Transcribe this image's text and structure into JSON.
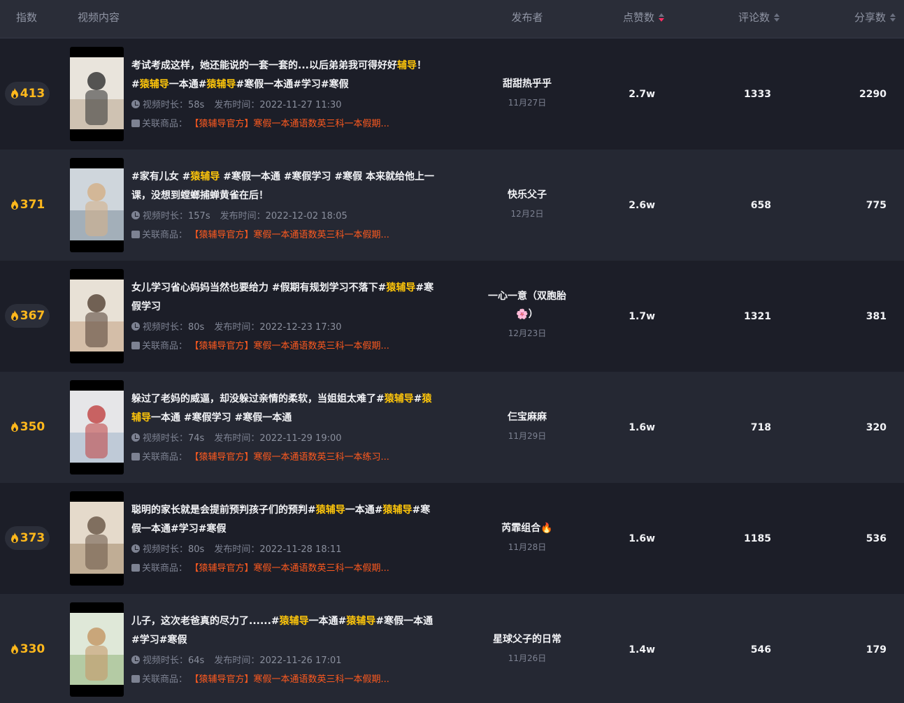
{
  "columns": {
    "index": "指数",
    "content": "视频内容",
    "author": "发布者",
    "likes": "点赞数",
    "comments": "评论数",
    "shares": "分享数"
  },
  "labels": {
    "duration": "视频时长：",
    "published": "发布时间：",
    "product": "关联商品："
  },
  "colors": {
    "accent": "#ffc60a",
    "index": "#ffb81c",
    "product": "#ff5a1f",
    "sort_active": "#ff2e63"
  },
  "rows": [
    {
      "index": "413",
      "title_parts": [
        {
          "t": "考试考成这样，她还能说的一套一套的...以后弟弟我可得好好",
          "h": false
        },
        {
          "t": "辅导",
          "h": true
        },
        {
          "t": "！ #",
          "h": false
        },
        {
          "t": "猿辅导",
          "h": true
        },
        {
          "t": "一本通#",
          "h": false
        },
        {
          "t": "猿辅导",
          "h": true
        },
        {
          "t": "#寒假一本通#学习#寒假",
          "h": false
        }
      ],
      "duration": "58s",
      "published": "2022-11-27 11:30",
      "product": "【猿辅导官方】寒假一本通语数英三科一本假期...",
      "author": "甜甜热乎乎",
      "author_date": "11月27日",
      "likes": "2.7w",
      "comments": "1333",
      "shares": "2290"
    },
    {
      "index": "371",
      "title_parts": [
        {
          "t": "#家有儿女 #",
          "h": false
        },
        {
          "t": "猿辅导",
          "h": true
        },
        {
          "t": " #寒假一本通 #寒假学习 #寒假 本来就给他上一课，没想到螳螂捕蝉黄雀在后！",
          "h": false
        }
      ],
      "duration": "157s",
      "published": "2022-12-02 18:05",
      "product": "【猿辅导官方】寒假一本通语数英三科一本假期...",
      "author": "快乐父子",
      "author_date": "12月2日",
      "likes": "2.6w",
      "comments": "658",
      "shares": "775"
    },
    {
      "index": "367",
      "title_parts": [
        {
          "t": "女儿学习省心妈妈当然也要给力 #假期有规划学习不落下#",
          "h": false
        },
        {
          "t": "猿辅导",
          "h": true
        },
        {
          "t": "#寒假学习",
          "h": false
        }
      ],
      "duration": "80s",
      "published": "2022-12-23 17:30",
      "product": "【猿辅导官方】寒假一本通语数英三科一本假期...",
      "author": "一心一意（双胞胎🌸）",
      "author_date": "12月23日",
      "likes": "1.7w",
      "comments": "1321",
      "shares": "381"
    },
    {
      "index": "350",
      "title_parts": [
        {
          "t": "躲过了老妈的威逼，却没躲过亲情的柔软，当姐姐太难了#",
          "h": false
        },
        {
          "t": "猿辅导",
          "h": true
        },
        {
          "t": "#",
          "h": false
        },
        {
          "t": "猿辅导",
          "h": true
        },
        {
          "t": "一本通 #寒假学习 #寒假一本通",
          "h": false
        }
      ],
      "duration": "74s",
      "published": "2022-11-29 19:00",
      "product": "【猿辅导官方】寒假一本通语数英三科一本练习...",
      "author": "仨宝麻麻",
      "author_date": "11月29日",
      "likes": "1.6w",
      "comments": "718",
      "shares": "320"
    },
    {
      "index": "373",
      "title_parts": [
        {
          "t": "聪明的家长就是会提前预判孩子们的预判#",
          "h": false
        },
        {
          "t": "猿辅导",
          "h": true
        },
        {
          "t": "一本通#",
          "h": false
        },
        {
          "t": "猿辅导",
          "h": true
        },
        {
          "t": "#寒假一本通#学习#寒假",
          "h": false
        }
      ],
      "duration": "80s",
      "published": "2022-11-28 18:11",
      "product": "【猿辅导官方】寒假一本通语数英三科一本假期...",
      "author": "芮霏组合🔥",
      "author_date": "11月28日",
      "likes": "1.6w",
      "comments": "1185",
      "shares": "536"
    },
    {
      "index": "330",
      "title_parts": [
        {
          "t": "儿子，这次老爸真的尽力了......#",
          "h": false
        },
        {
          "t": "猿辅导",
          "h": true
        },
        {
          "t": "一本通#",
          "h": false
        },
        {
          "t": "猿辅导",
          "h": true
        },
        {
          "t": "#寒假一本通#学习#寒假",
          "h": false
        }
      ],
      "duration": "64s",
      "published": "2022-11-26 17:01",
      "product": "【猿辅导官方】寒假一本通语数英三科一本假期...",
      "author": "星球父子的日常",
      "author_date": "11月26日",
      "likes": "1.4w",
      "comments": "546",
      "shares": "179"
    }
  ]
}
